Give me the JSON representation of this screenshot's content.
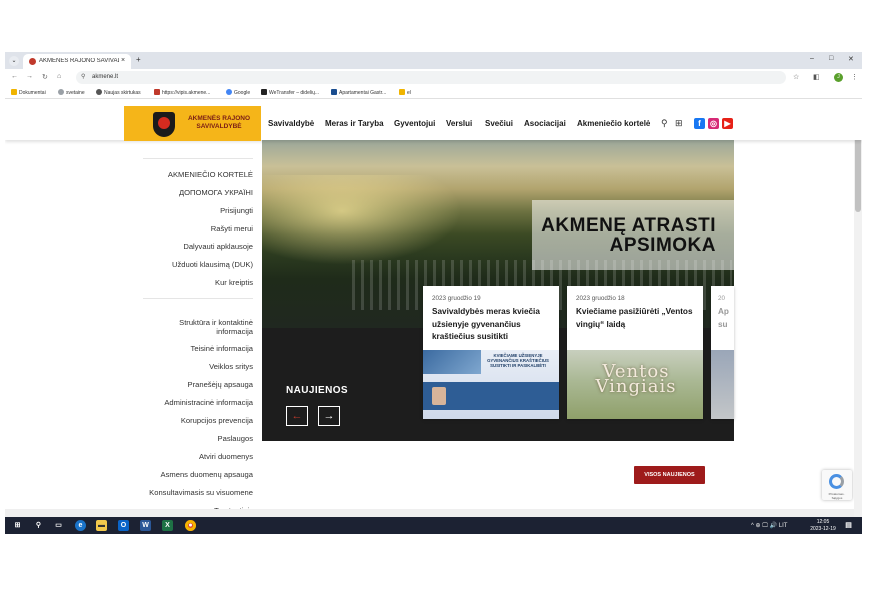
{
  "browser": {
    "tab_title": "AKMENĖS RAJONO SAVIVALD",
    "tab_close": "×",
    "new_tab": "+",
    "url": "akmene.lt",
    "window_controls": [
      "–",
      "□",
      "✕"
    ],
    "bookmarks": [
      {
        "label": "Dokumentai",
        "color": "#f0b400"
      },
      {
        "label": "svetaine",
        "color": "#9aa0a6"
      },
      {
        "label": "Naujas skirtukas",
        "color": "#555555"
      },
      {
        "label": "https://vipis.akmene...",
        "color": "#c0392b"
      },
      {
        "label": "Google",
        "color": "#4285f4"
      },
      {
        "label": "WeTransfer – didelių...",
        "color": "#222222"
      },
      {
        "label": "Apartamentai Gastr...",
        "color": "#1a4d8f"
      },
      {
        "label": "el",
        "color": "#f0b400"
      }
    ]
  },
  "site": {
    "logo_text": "AKMENĖS RAJONO SAVIVALDYBĖ",
    "menu": [
      "Savivaldybė",
      "Meras ir Taryba",
      "Gyventojui",
      "Verslui",
      "Svečiui",
      "Asociacijai",
      "Akmeniečio kortelė"
    ],
    "sidebar_top": [
      "AKMENIEČIO KORTELĖ",
      "ДОПОМОГА УКРАЇНІ",
      "Prisijungti",
      "Rašyti merui",
      "Dalyvauti apklausoje",
      "Užduoti klausimą (DUK)",
      "Kur kreiptis"
    ],
    "sidebar_bottom": [
      "Struktūra ir kontaktinė informacija",
      "Teisinė informacija",
      "Veiklos sritys",
      "Pranešėjų apsauga",
      "Administracinė informacija",
      "Korupcijos prevencija",
      "Paslaugos",
      "Atviri duomenys",
      "Asmens duomenų apsauga",
      "Konsultavimasis su visuomene",
      "Tarptautinis bendradarbiavimas"
    ],
    "hero_line1": "AKMENĘ ATRASTI",
    "hero_line2": "APSIMOKA",
    "news_label": "NAUJIENOS",
    "news": [
      {
        "date": "2023 gruodžio 19",
        "title": "Savivaldybės meras kviečia užsienyje gyvenančius kraštiečius susitikti",
        "image_caption": "KVIEČIAME UŽSIENYJE GYVENANČIUS KRAŠTIEČIUS SUSITIKTI IR PASIKALBĖTI"
      },
      {
        "date": "2023 gruodžio 18",
        "title": "Kviečiame pasižiūrėti „Ventos vingių“ laidą",
        "image_caption": "Ventos Vingiais"
      },
      {
        "date": "20",
        "title": "Ap su",
        "image_caption": ""
      }
    ],
    "all_news_button": "VISOS NAUJIENOS"
  },
  "taskbar": {
    "tray_text": "^ ⊕ 🖵 🔊 LIT",
    "time": "12:05",
    "date": "2023-12-19"
  },
  "colors": {
    "brand_yellow": "#f5b519",
    "brand_red": "#9e1b1b",
    "dark_panel": "#1d1d1d",
    "taskbar": "#1c2233"
  }
}
